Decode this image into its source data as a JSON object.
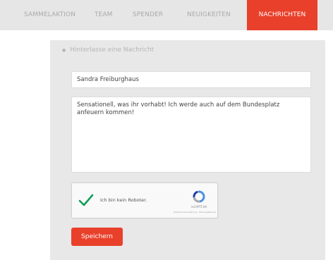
{
  "tabs": [
    {
      "label": "Sammelaktion",
      "active": false
    },
    {
      "label": "Team",
      "active": false
    },
    {
      "label": "Spender",
      "active": false
    },
    {
      "label": "Neuigkeiten",
      "active": false
    },
    {
      "label": "Nachrichten",
      "active": true
    }
  ],
  "form": {
    "section_label": "Hinterlasse eine Nachricht",
    "name_value": "Sandra Freiburghaus",
    "message_value": "Sensationell, was ihr vorhabt! Ich werde auch auf dem Bundesplatz anfeuern kommen!",
    "save_label": "Speichern"
  },
  "captcha": {
    "label": "Ich bin kein Roboter.",
    "brand": "reCAPTCHA",
    "terms": "Datenschutzerklärung · Nutzungsbedingungen",
    "checked": true
  },
  "colors": {
    "accent": "#e9402b",
    "tabbar_bg": "#e6e6e6",
    "panel_bg": "#e8e8e8",
    "check_green": "#0f9d58",
    "recaptcha_blue": "#4a90e2"
  }
}
